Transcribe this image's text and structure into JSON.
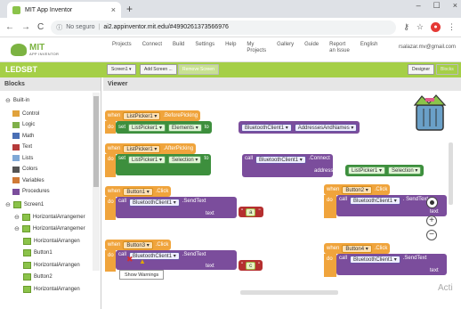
{
  "browser": {
    "tab_title": "MIT App Inventor",
    "tab_close": "×",
    "new_tab": "+",
    "win_min": "–",
    "win_max": "☐",
    "win_close": "×",
    "security": "No seguro",
    "url": "ai2.appinventor.mit.edu/#4990261373566976"
  },
  "app": {
    "logo_text": "MIT",
    "logo_sub": "APP INVENTOR",
    "menu": [
      {
        "l1": "Projects"
      },
      {
        "l1": "Connect"
      },
      {
        "l1": "Build"
      },
      {
        "l1": "Settings"
      },
      {
        "l1": "Help"
      },
      {
        "l1": "My",
        "l2": "Projects"
      },
      {
        "l1": "Gallery"
      },
      {
        "l1": "Guide"
      },
      {
        "l1": "Report",
        "l2": "an Issue"
      },
      {
        "l1": "English"
      }
    ],
    "user": "rsalazar.mv@gmail.com"
  },
  "project": {
    "name": "LEDSBT",
    "screen_btn": "Screen1 ▾",
    "add_screen": "Add Screen ...",
    "remove_screen": "Remove Screen",
    "designer": "Designer",
    "blocks": "Blocks"
  },
  "panel": {
    "blocks_title": "Blocks",
    "viewer_title": "Viewer",
    "builtin": "Built-in",
    "builtin_items": [
      {
        "label": "Control",
        "color": "#e0a23c"
      },
      {
        "label": "Logic",
        "color": "#7fb04a"
      },
      {
        "label": "Math",
        "color": "#4a6fb5"
      },
      {
        "label": "Text",
        "color": "#b53a3a"
      },
      {
        "label": "Lists",
        "color": "#7fa8d6"
      },
      {
        "label": "Colors",
        "color": "#555555"
      },
      {
        "label": "Variables",
        "color": "#d07a36"
      },
      {
        "label": "Procedures",
        "color": "#7b4d9c"
      }
    ],
    "components": [
      {
        "label": "Screen1",
        "indent": 0
      },
      {
        "label": "HorizontalArrangemer",
        "indent": 1
      },
      {
        "label": "HorizontalArrangemer",
        "indent": 1
      },
      {
        "label": "HorizontalArrangen",
        "indent": 2
      },
      {
        "label": "Button1",
        "indent": 2
      },
      {
        "label": "HorizontalArrangen",
        "indent": 2
      },
      {
        "label": "Button2",
        "indent": 2
      },
      {
        "label": "HorizontalArrangen",
        "indent": 2
      }
    ]
  },
  "blocks": {
    "when": "when",
    "do": "do",
    "set": "set",
    "call": "call",
    "to": "to",
    "text": "text",
    "address": "address",
    "connect": "Connect",
    "lp1": "ListPicker1 ▾",
    "before_picking": ".BeforePicking",
    "after_picking": ".AfterPicking",
    "elements": "Elements ▾",
    "selection": "Selection ▾",
    "bt": "BluetoothClient1 ▾",
    "addresses": "AddressesAndNames ▾",
    "b1": "Button1 ▾",
    "b2": "Button2 ▾",
    "b3": "Button3 ▾",
    "b4": "Button4 ▾",
    "click": ".Click",
    "sendtext": ".SendText",
    "send_short": ". SendText",
    "connect_dot": ".Connect",
    "val_a": "a",
    "val_c": "c",
    "show_warnings": "Show Warnings",
    "zoom_in": "+",
    "zoom_out": "−",
    "activate": "Acti"
  }
}
